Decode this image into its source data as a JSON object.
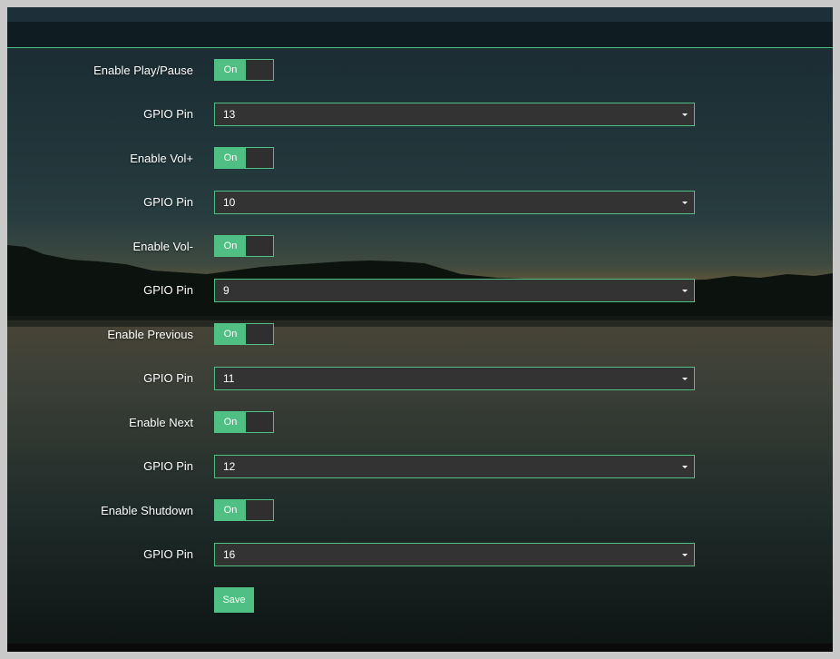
{
  "settings": [
    {
      "type": "toggle",
      "label": "Enable Play/Pause",
      "value": "On"
    },
    {
      "type": "select",
      "label": "GPIO Pin",
      "value": "13"
    },
    {
      "type": "toggle",
      "label": "Enable Vol+",
      "value": "On"
    },
    {
      "type": "select",
      "label": "GPIO Pin",
      "value": "10"
    },
    {
      "type": "toggle",
      "label": "Enable Vol-",
      "value": "On"
    },
    {
      "type": "select",
      "label": "GPIO Pin",
      "value": "9"
    },
    {
      "type": "toggle",
      "label": "Enable Previous",
      "value": "On"
    },
    {
      "type": "select",
      "label": "GPIO Pin",
      "value": "11"
    },
    {
      "type": "toggle",
      "label": "Enable Next",
      "value": "On"
    },
    {
      "type": "select",
      "label": "GPIO Pin",
      "value": "12"
    },
    {
      "type": "toggle",
      "label": "Enable Shutdown",
      "value": "On"
    },
    {
      "type": "select",
      "label": "GPIO Pin",
      "value": "16"
    }
  ],
  "save_label": "Save",
  "colors": {
    "accent": "#4fbf83",
    "field_bg": "#333333"
  },
  "icons": {
    "select_arrow": "caret-down-icon"
  }
}
